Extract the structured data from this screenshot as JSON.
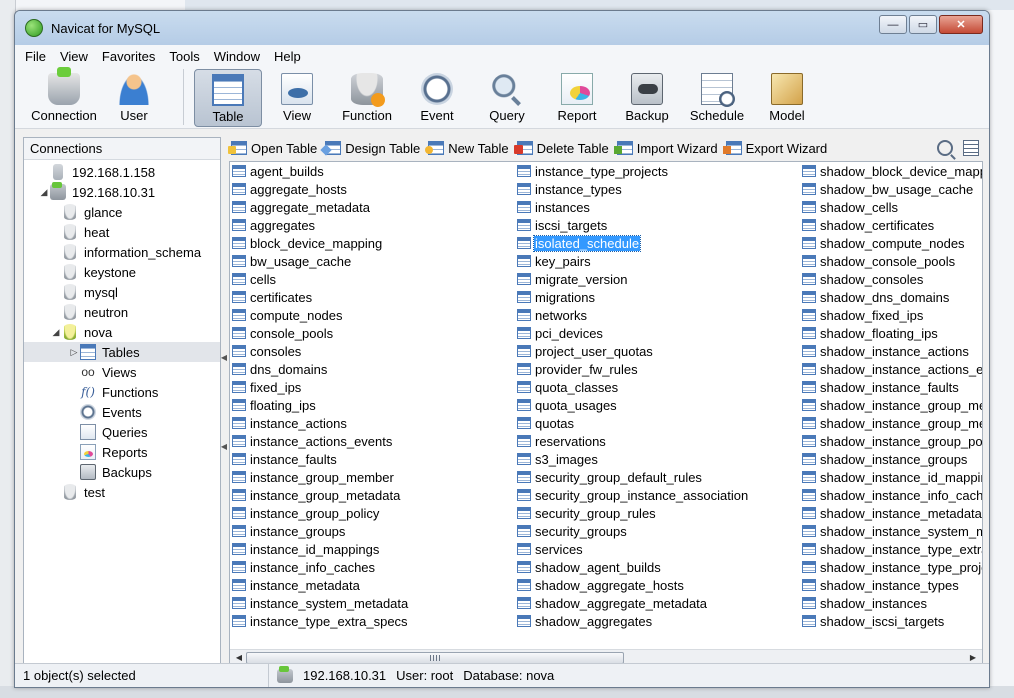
{
  "window": {
    "title": "Navicat for MySQL",
    "controls": {
      "minimize": "—",
      "maximize": "▭",
      "close": "✕"
    }
  },
  "menu": [
    "File",
    "View",
    "Favorites",
    "Tools",
    "Window",
    "Help"
  ],
  "toolbar": [
    {
      "label": "Connection",
      "icon": "connection-icon"
    },
    {
      "label": "User",
      "icon": "user-icon"
    },
    {
      "label": "Table",
      "icon": "table-icon",
      "active": true
    },
    {
      "label": "View",
      "icon": "view-icon"
    },
    {
      "label": "Function",
      "icon": "function-icon"
    },
    {
      "label": "Event",
      "icon": "event-icon"
    },
    {
      "label": "Query",
      "icon": "query-icon"
    },
    {
      "label": "Report",
      "icon": "report-icon"
    },
    {
      "label": "Backup",
      "icon": "backup-icon"
    },
    {
      "label": "Schedule",
      "icon": "schedule-icon"
    },
    {
      "label": "Model",
      "icon": "model-icon"
    }
  ],
  "connections": {
    "header": "Connections",
    "items": [
      {
        "label": "192.168.1.158",
        "icon": "server",
        "expander": ""
      },
      {
        "label": "192.168.10.31",
        "icon": "server-green",
        "expander": "◢"
      },
      {
        "label": "glance",
        "icon": "db"
      },
      {
        "label": "heat",
        "icon": "db"
      },
      {
        "label": "information_schema",
        "icon": "db"
      },
      {
        "label": "keystone",
        "icon": "db"
      },
      {
        "label": "mysql",
        "icon": "db"
      },
      {
        "label": "neutron",
        "icon": "db"
      },
      {
        "label": "nova",
        "icon": "db-green",
        "expander": "◢"
      },
      {
        "label": "Tables",
        "icon": "tables",
        "expander": "▷",
        "selected": true
      },
      {
        "label": "Views",
        "icon": "views"
      },
      {
        "label": "Functions",
        "icon": "functions"
      },
      {
        "label": "Events",
        "icon": "events"
      },
      {
        "label": "Queries",
        "icon": "queries"
      },
      {
        "label": "Reports",
        "icon": "reports"
      },
      {
        "label": "Backups",
        "icon": "backups"
      },
      {
        "label": "test",
        "icon": "db"
      }
    ]
  },
  "object_toolbar": {
    "open_table": "Open Table",
    "design_table": "Design Table",
    "new_table": "New Table",
    "delete_table": "Delete Table",
    "import_wizard": "Import Wizard",
    "export_wizard": "Export Wizard"
  },
  "tables": {
    "selected": "isolated_schedule",
    "columns": [
      [
        "agent_builds",
        "aggregate_hosts",
        "aggregate_metadata",
        "aggregates",
        "block_device_mapping",
        "bw_usage_cache",
        "cells",
        "certificates",
        "compute_nodes",
        "console_pools",
        "consoles",
        "dns_domains",
        "fixed_ips",
        "floating_ips",
        "instance_actions",
        "instance_actions_events",
        "instance_faults",
        "instance_group_member",
        "instance_group_metadata",
        "instance_group_policy",
        "instance_groups",
        "instance_id_mappings",
        "instance_info_caches",
        "instance_metadata",
        "instance_system_metadata",
        "instance_type_extra_specs"
      ],
      [
        "instance_type_projects",
        "instance_types",
        "instances",
        "iscsi_targets",
        "isolated_schedule",
        "key_pairs",
        "migrate_version",
        "migrations",
        "networks",
        "pci_devices",
        "project_user_quotas",
        "provider_fw_rules",
        "quota_classes",
        "quota_usages",
        "quotas",
        "reservations",
        "s3_images",
        "security_group_default_rules",
        "security_group_instance_association",
        "security_group_rules",
        "security_groups",
        "services",
        "shadow_agent_builds",
        "shadow_aggregate_hosts",
        "shadow_aggregate_metadata",
        "shadow_aggregates"
      ],
      [
        "shadow_block_device_mapp",
        "shadow_bw_usage_cache",
        "shadow_cells",
        "shadow_certificates",
        "shadow_compute_nodes",
        "shadow_console_pools",
        "shadow_consoles",
        "shadow_dns_domains",
        "shadow_fixed_ips",
        "shadow_floating_ips",
        "shadow_instance_actions",
        "shadow_instance_actions_ev",
        "shadow_instance_faults",
        "shadow_instance_group_me",
        "shadow_instance_group_me",
        "shadow_instance_group_pol",
        "shadow_instance_groups",
        "shadow_instance_id_mappin",
        "shadow_instance_info_cache",
        "shadow_instance_metadata",
        "shadow_instance_system_me",
        "shadow_instance_type_extra",
        "shadow_instance_type_proje",
        "shadow_instance_types",
        "shadow_instances",
        "shadow_iscsi_targets"
      ]
    ]
  },
  "status": {
    "selection": "1 object(s) selected",
    "connection": "192.168.10.31",
    "user": "User: root",
    "database": "Database: nova"
  }
}
